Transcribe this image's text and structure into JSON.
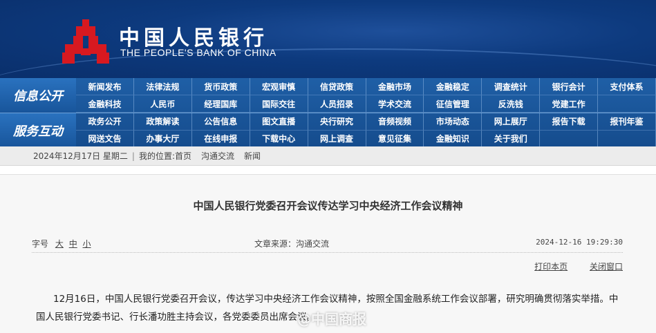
{
  "header": {
    "cn_name": "中国人民银行",
    "en_name": "THE PEOPLE'S BANK OF CHINA",
    "logo_icon": "pboc-logo-icon",
    "brand_color": "#d71920"
  },
  "nav": {
    "section1": {
      "title": "信息公开",
      "items": [
        "新闻发布",
        "法律法规",
        "货币政策",
        "宏观审慎",
        "信贷政策",
        "金融市场",
        "金融稳定",
        "调查统计",
        "银行会计",
        "支付体系",
        "金融科技",
        "人民币",
        "经理国库",
        "国际交往",
        "人员招录",
        "学术交流",
        "征信管理",
        "反洗钱",
        "党建工作",
        ""
      ]
    },
    "section2": {
      "title": "服务互动",
      "items": [
        "政务公开",
        "政策解读",
        "公告信息",
        "图文直播",
        "央行研究",
        "音频视频",
        "市场动态",
        "网上展厅",
        "报告下载",
        "报刊年鉴",
        "网送文告",
        "办事大厅",
        "在线申报",
        "下载中心",
        "网上调查",
        "意见征集",
        "金融知识",
        "关于我们",
        "",
        ""
      ]
    }
  },
  "breadcrumb": {
    "date": "2024年12月17日 星期二",
    "prefix": "我的位置:",
    "items": [
      "首页",
      "沟通交流",
      "新闻"
    ]
  },
  "article": {
    "title": "中国人民银行党委召开会议传达学习中央经济工作会议精神",
    "font_size_label": "字号",
    "font_sizes": [
      "大",
      "中",
      "小"
    ],
    "source": "文章来源：沟通交流",
    "datetime": "2024-12-16 19:29:30",
    "print_label": "打印本页",
    "close_label": "关闭窗口",
    "body": "12月16日，中国人民银行党委召开会议，传达学习中央经济工作会议精神，按照全国金融系统工作会议部署，研究明确贯彻落实举措。中国人民银行党委书记、行长潘功胜主持会议，各党委委员出席会议。",
    "watermark": "@中国商报"
  }
}
